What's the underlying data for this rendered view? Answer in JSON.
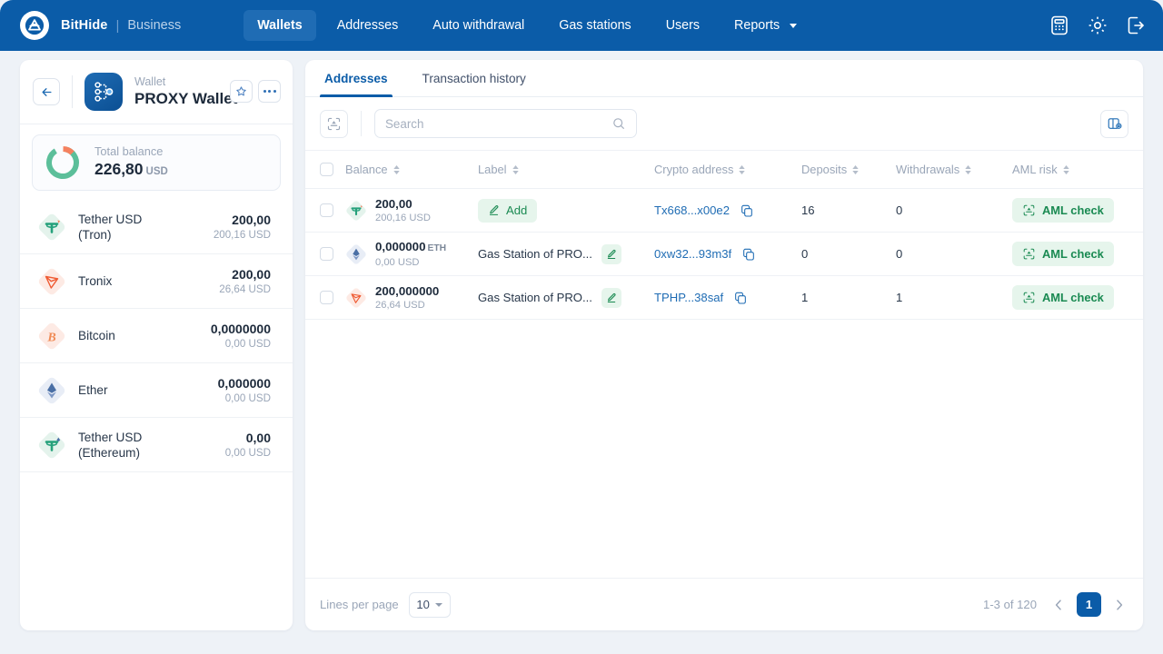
{
  "topnav": {
    "brand": "BitHide",
    "brand_sub": "Business",
    "logo_icon": "bithide-logo-icon",
    "items": [
      {
        "label": "Wallets",
        "active": true
      },
      {
        "label": "Addresses",
        "active": false
      },
      {
        "label": "Auto withdrawal",
        "active": false
      },
      {
        "label": "Gas stations",
        "active": false
      },
      {
        "label": "Users",
        "active": false
      },
      {
        "label": "Reports",
        "active": false,
        "has_caret": true
      }
    ],
    "right_icons": [
      "calculator-icon",
      "gear-icon",
      "logout-icon"
    ],
    "bg_color": "#0b5ca8",
    "active_bg_color": "#1f6cb4"
  },
  "sidebar": {
    "back_icon": "arrow-left-icon",
    "wallet_icon": "proxy-wallet-icon",
    "wallet_kicker": "Wallet",
    "wallet_title": "PROXY Wallet",
    "favorite_icon": "star-icon",
    "more_icon": "ellipsis-icon",
    "balance": {
      "label": "Total balance",
      "value": "226,80",
      "currency": "USD",
      "donut": {
        "green_pct": 88,
        "orange_pct": 12,
        "green": "#5cbf9a",
        "orange": "#f5815f"
      }
    },
    "coins": [
      {
        "name": "Tether USD\n(Tron)",
        "name_line1": "Tether USD",
        "name_line2": "(Tron)",
        "amount": "200,00",
        "usd": "200,16 USD",
        "icon": "tether-tron-icon"
      },
      {
        "name": "Tronix",
        "name_line1": "Tronix",
        "name_line2": "",
        "amount": "200,00",
        "usd": "26,64 USD",
        "icon": "tron-icon"
      },
      {
        "name": "Bitcoin",
        "name_line1": "Bitcoin",
        "name_line2": "",
        "amount": "0,0000000",
        "usd": "0,00 USD",
        "icon": "bitcoin-icon"
      },
      {
        "name": "Ether",
        "name_line1": "Ether",
        "name_line2": "",
        "amount": "0,000000",
        "usd": "0,00 USD",
        "icon": "ethereum-icon"
      },
      {
        "name": "Tether USD\n(Ethereum)",
        "name_line1": "Tether USD",
        "name_line2": "(Ethereum)",
        "amount": "0,00",
        "usd": "0,00 USD",
        "icon": "tether-eth-icon"
      }
    ]
  },
  "main": {
    "tabs": [
      {
        "label": "Addresses",
        "active": true
      },
      {
        "label": "Transaction history",
        "active": false
      }
    ],
    "toolbar": {
      "scan_icon": "address-scan-icon",
      "search_placeholder": "Search",
      "search_value": "",
      "search_icon": "search-icon",
      "columns_icon": "column-settings-icon"
    },
    "table": {
      "select_all_checked": false,
      "columns": [
        {
          "label": "Balance",
          "sortable": true
        },
        {
          "label": "Label",
          "sortable": true
        },
        {
          "label": "Crypto address",
          "sortable": true
        },
        {
          "label": "Deposits",
          "sortable": true
        },
        {
          "label": "Withdrawals",
          "sortable": true
        },
        {
          "label": "AML risk",
          "sortable": true
        }
      ],
      "rows": [
        {
          "checked": false,
          "coin_icon": "tether-tron-icon",
          "amount": "200,00",
          "unit": "",
          "usd": "200,16 USD",
          "label_type": "add",
          "label_text": "Add",
          "address": "Tx668...x00e2",
          "deposits": "16",
          "withdrawals": "0",
          "aml": "AML check"
        },
        {
          "checked": false,
          "coin_icon": "ethereum-icon",
          "amount": "0,000000",
          "unit": "ETH",
          "usd": "0,00 USD",
          "label_type": "text",
          "label_text": "Gas Station of PRO...",
          "address": "0xw32...93m3f",
          "deposits": "0",
          "withdrawals": "0",
          "aml": "AML check"
        },
        {
          "checked": false,
          "coin_icon": "tron-icon",
          "amount": "200,000000",
          "unit": "",
          "usd": "26,64 USD",
          "label_type": "text",
          "label_text": "Gas Station of PRO...",
          "address": "TPHP...38saf",
          "deposits": "1",
          "withdrawals": "1",
          "aml": "AML check"
        }
      ]
    },
    "footer": {
      "lines_per_page_label": "Lines per page",
      "lines_per_page_value": "10",
      "range": "1-3 of 120",
      "prev_icon": "chevron-left-icon",
      "next_icon": "chevron-right-icon",
      "current_page": "1"
    }
  },
  "colors": {
    "brand_blue": "#0b5ca8",
    "link_blue": "#1f6cb4",
    "green": "#1a8a52",
    "green_bg": "#e6f5ec",
    "orange": "#f5815f"
  }
}
